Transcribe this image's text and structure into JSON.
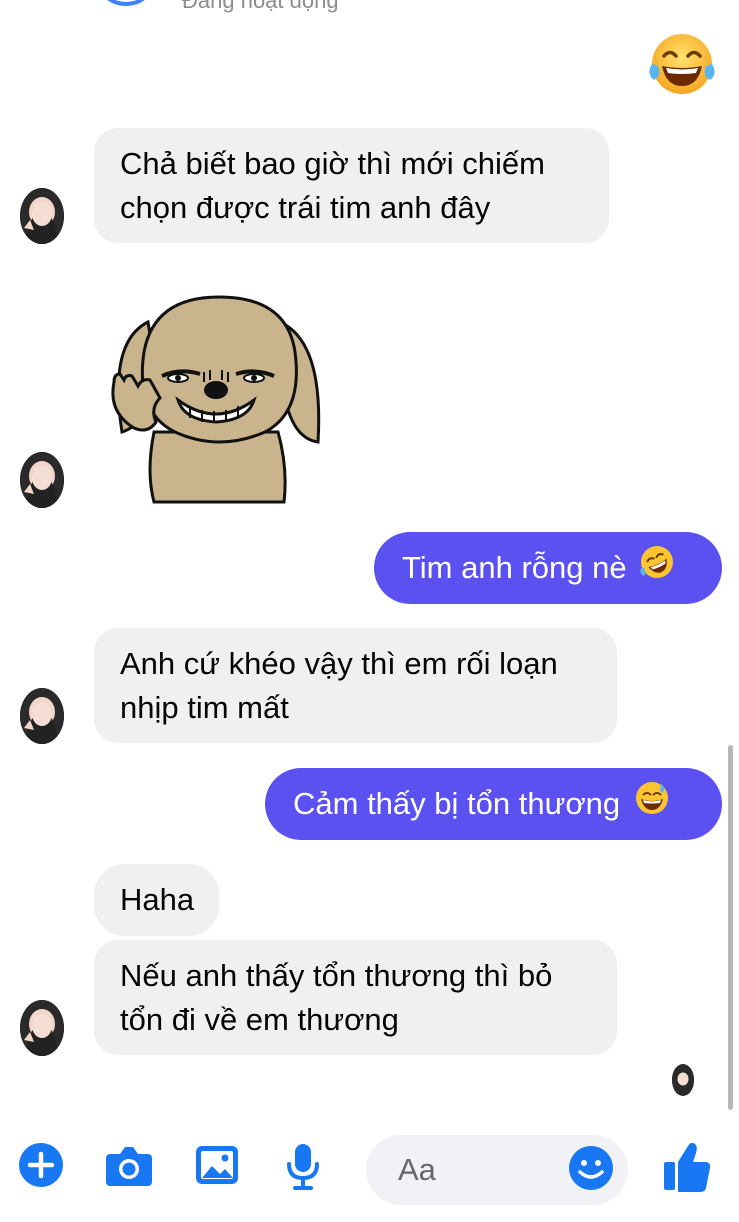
{
  "header": {
    "status_text": "Đang hoạt động"
  },
  "messages": [
    {
      "id": "m1",
      "direction": "outgoing",
      "kind": "emoji",
      "emoji": "face-with-tears-of-joy"
    },
    {
      "id": "m2",
      "direction": "incoming",
      "kind": "text",
      "lines": [
        "Chả biết bao giờ thì mới chiếm",
        "chọn được trái tim anh đây"
      ]
    },
    {
      "id": "m3",
      "direction": "incoming",
      "kind": "sticker",
      "sticker": "dog-smirk-sticker"
    },
    {
      "id": "m4",
      "direction": "outgoing",
      "kind": "text",
      "text": "Tim anh rỗng nè",
      "emoji": "rolling-on-floor-laughing"
    },
    {
      "id": "m5",
      "direction": "incoming",
      "kind": "text",
      "lines": [
        "Anh cứ khéo vậy thì em rối loạn",
        "nhịp tim mất"
      ]
    },
    {
      "id": "m6",
      "direction": "outgoing",
      "kind": "text",
      "text": "Cảm thấy bị tổn thương",
      "emoji": "grinning-face-with-sweat"
    },
    {
      "id": "m7",
      "direction": "incoming",
      "kind": "text",
      "lines": [
        "Haha"
      ]
    },
    {
      "id": "m8",
      "direction": "incoming",
      "kind": "text",
      "lines": [
        "Nếu anh thấy tổn thương thì bỏ",
        "tổn đi về em thương"
      ]
    }
  ],
  "composer": {
    "placeholder": "Aa",
    "toolbar_icons": [
      "plus-icon",
      "camera-icon",
      "image-icon",
      "microphone-icon"
    ],
    "emoji_button_icon": "smiley-icon",
    "like_button_icon": "thumbs-up-icon"
  },
  "colors": {
    "accent": "#5b51f0",
    "incoming_bubble": "#f0f0f0",
    "toolbar_icon": "#1877f2"
  }
}
